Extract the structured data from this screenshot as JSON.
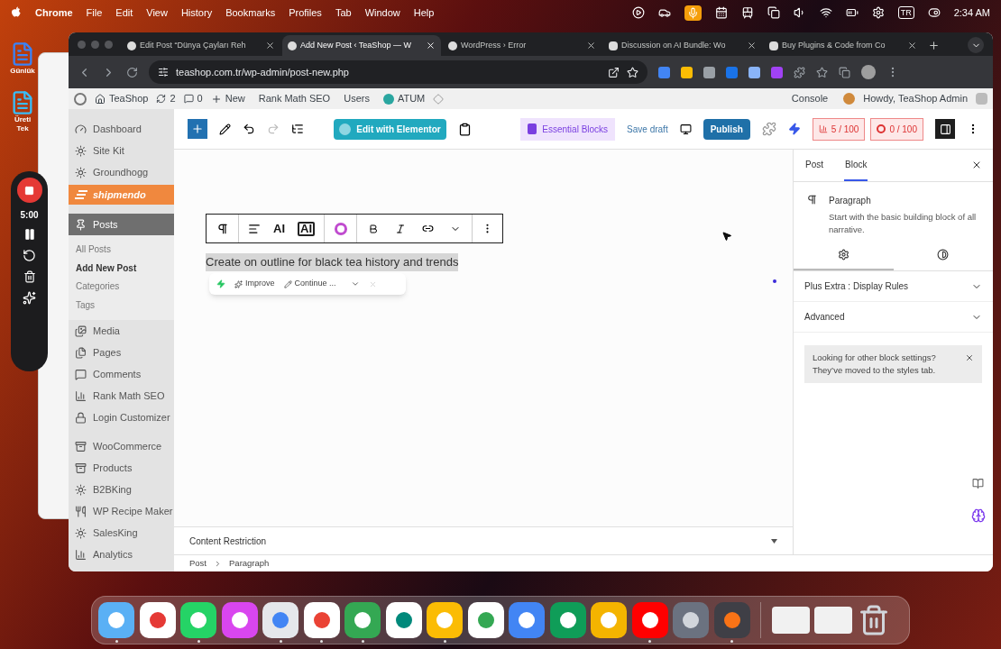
{
  "menubar": {
    "app": "Chrome",
    "items": [
      "File",
      "Edit",
      "View",
      "History",
      "Bookmarks",
      "Profiles",
      "Tab",
      "Window",
      "Help"
    ],
    "input_source": "TR",
    "time": "2:34 AM"
  },
  "desktop_icons": [
    {
      "lines": [
        "Günlük"
      ]
    },
    {
      "lines": [
        "Üreti",
        "Tek"
      ]
    }
  ],
  "recorder": {
    "timer": "5:00"
  },
  "browser": {
    "tabs": [
      {
        "title": "Edit Post “Dünya Çayları Reh",
        "selected": false
      },
      {
        "title": "Add New Post ‹ TeaShop — W",
        "selected": true
      },
      {
        "title": "WordPress › Error",
        "selected": false
      },
      {
        "title": "Discussion on AI Bundle: Wo",
        "selected": false
      },
      {
        "title": "Buy Plugins & Code from Co",
        "selected": false
      }
    ],
    "url": "teashop.com.tr/wp-admin/post-new.php"
  },
  "admin_bar": {
    "site": "TeaShop",
    "updates": "2",
    "comments": "0",
    "new": "New",
    "items": [
      "Rank Math SEO",
      "Users",
      "ATUM"
    ],
    "console": "Console",
    "greeting": "Howdy, TeaShop Admin"
  },
  "sidebar": [
    {
      "label": "Dashboard",
      "kind": "menu",
      "selected": false
    },
    {
      "label": "Site Kit",
      "kind": "menu",
      "selected": false
    },
    {
      "label": "Groundhogg",
      "kind": "menu",
      "selected": false
    },
    {
      "label": "shipmendo",
      "kind": "brand",
      "selected": false
    },
    {
      "label": "Posts",
      "kind": "menu",
      "selected": true,
      "children": [
        {
          "label": "All Posts",
          "selected": false
        },
        {
          "label": "Add New Post",
          "selected": true
        },
        {
          "label": "Categories",
          "selected": false
        },
        {
          "label": "Tags",
          "selected": false
        }
      ]
    },
    {
      "label": "Media",
      "kind": "menu",
      "selected": false
    },
    {
      "label": "Pages",
      "kind": "menu",
      "selected": false
    },
    {
      "label": "Comments",
      "kind": "menu",
      "selected": false
    },
    {
      "label": "Rank Math SEO",
      "kind": "menu",
      "selected": false
    },
    {
      "label": "Login Customizer",
      "kind": "menu",
      "selected": false
    },
    {
      "kind": "separator"
    },
    {
      "label": "WooCommerce",
      "kind": "menu",
      "selected": false
    },
    {
      "label": "Products",
      "kind": "menu",
      "selected": false
    },
    {
      "label": "B2BKing",
      "kind": "menu",
      "selected": false
    },
    {
      "label": "WP Recipe Maker",
      "kind": "menu",
      "selected": false
    },
    {
      "label": "SalesKing",
      "kind": "menu",
      "selected": false
    },
    {
      "label": "Analytics",
      "kind": "menu",
      "selected": false
    }
  ],
  "toolbar": {
    "elementor": "Edit with Elementor",
    "essential_blocks": "Essential Blocks",
    "save_draft": "Save draft",
    "publish": "Publish",
    "seo_score": "5 / 100",
    "content_score": "0 / 100"
  },
  "editor": {
    "block_toolbar": {
      "ai_buttons": [
        "AI",
        "AI"
      ]
    },
    "paragraph": "Create on outline for black tea history and trends",
    "ai_bar": {
      "improve": "Improve",
      "continue": "Continue ..."
    }
  },
  "panel": {
    "tabs": [
      {
        "label": "Post",
        "selected": false
      },
      {
        "label": "Block",
        "selected": true
      }
    ],
    "block_name": "Paragraph",
    "block_description": "Start with the basic building block of all narrative.",
    "settings_tabs": [
      {
        "selected": true
      },
      {
        "selected": false
      }
    ],
    "sections": [
      "Plus Extra : Display Rules",
      "Advanced"
    ],
    "notice": "Looking for other block settings? They’ve moved to the styles tab."
  },
  "content_restriction": "Content Restriction",
  "breadcrumbs": [
    "Post",
    "Paragraph"
  ],
  "dock": [
    {
      "running": true
    },
    {
      "running": false
    },
    {
      "running": true
    },
    {
      "running": false
    },
    {
      "running": true
    },
    {
      "running": true
    },
    {
      "running": true
    },
    {
      "running": false
    },
    {
      "running": true
    },
    {
      "running": false
    },
    {
      "running": false
    },
    {
      "running": false
    },
    {
      "running": false
    },
    {
      "running": true
    },
    {
      "running": false
    },
    {
      "running": true
    }
  ]
}
